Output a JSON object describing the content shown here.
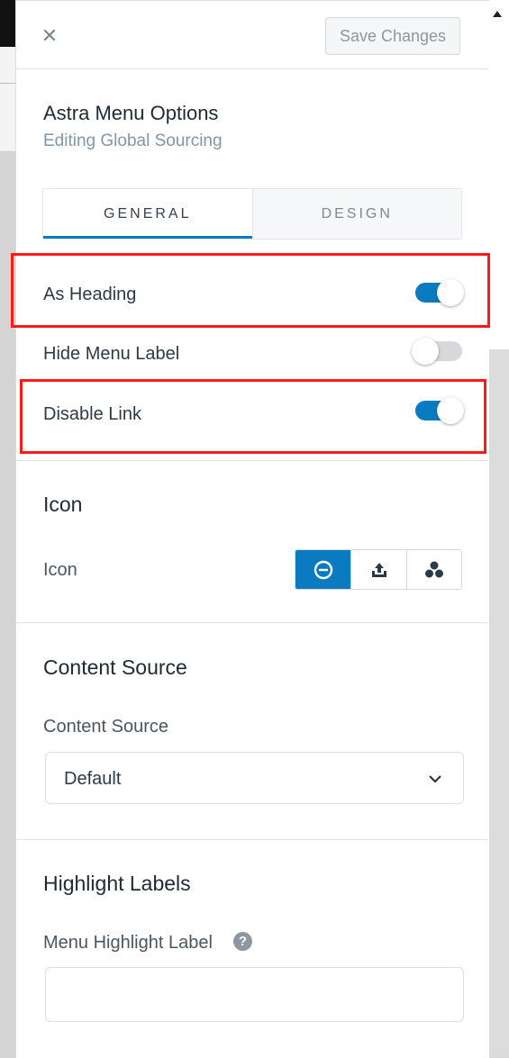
{
  "header": {
    "close_glyph": "✕",
    "save_label": "Save Changes"
  },
  "menu_options": {
    "title": "Astra Menu Options",
    "subtitle": "Editing Global Sourcing"
  },
  "tabs": [
    {
      "label": "GENERAL",
      "active": true
    },
    {
      "label": "DESIGN",
      "active": false
    }
  ],
  "toggles": [
    {
      "label": "As Heading",
      "on": true,
      "highlighted": true
    },
    {
      "label": "Hide Menu Label",
      "on": false,
      "highlighted": false
    },
    {
      "label": "Disable Link",
      "on": true,
      "highlighted": true
    }
  ],
  "icon_section": {
    "title": "Icon",
    "label": "Icon",
    "options": [
      {
        "icon": "no-icon-circle-minus",
        "selected": true
      },
      {
        "icon": "upload-icon",
        "selected": false
      },
      {
        "icon": "dashicons-icon",
        "selected": false
      }
    ]
  },
  "content_source": {
    "title": "Content Source",
    "label": "Content Source",
    "selected": "Default"
  },
  "highlight_labels": {
    "title": "Highlight Labels",
    "label": "Menu Highlight Label",
    "help_glyph": "?",
    "value": ""
  },
  "colors": {
    "accent": "#0b7bc1",
    "highlight_border": "#ff1a1a"
  }
}
